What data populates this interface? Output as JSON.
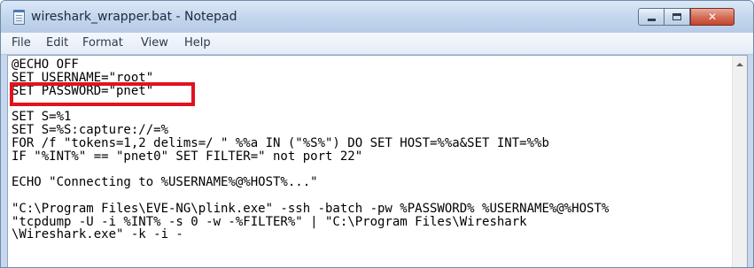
{
  "window": {
    "title": "wireshark_wrapper.bat - Notepad",
    "close_glyph": "✕"
  },
  "menu": {
    "items": [
      "File",
      "Edit",
      "Format",
      "View",
      "Help"
    ]
  },
  "editor": {
    "lines": [
      "@ECHO OFF",
      "SET USERNAME=\"root\"",
      "SET PASSWORD=\"pnet\"",
      "",
      "SET S=%1",
      "SET S=%S:capture://=%",
      "FOR /f \"tokens=1,2 delims=/ \" %%a IN (\"%S%\") DO SET HOST=%%a&SET INT=%%b",
      "IF \"%INT%\" == \"pnet0\" SET FILTER=\" not port 22\"",
      "",
      "ECHO \"Connecting to %USERNAME%@%HOST%...\"",
      "",
      "\"C:\\Program Files\\EVE-NG\\plink.exe\" -ssh -batch -pw %PASSWORD% %USERNAME%@%HOST%",
      "\"tcpdump -U -i %INT% -s 0 -w -%FILTER%\" | \"C:\\Program Files\\Wireshark",
      "\\Wireshark.exe\" -k -i -"
    ]
  },
  "colors": {
    "highlight": "#e0131f"
  },
  "icons": {
    "app": "notepad-icon",
    "minimize": "minimize-icon",
    "maximize": "maximize-icon",
    "close": "close-icon",
    "scroll_up": "scroll-up-arrow-icon"
  }
}
